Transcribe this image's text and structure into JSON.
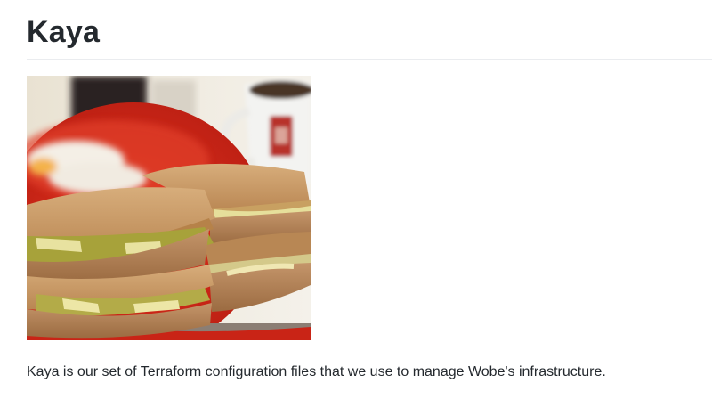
{
  "readme": {
    "title": "Kaya",
    "image": {
      "alt": "Kaya toast sandwiches on a red plate with soft-boiled eggs and a cup of coffee"
    },
    "description": "Kaya is our set of Terraform configuration files that we use to manage Wobe's infrastructure."
  },
  "colors": {
    "text": "#24292e",
    "divider": "#eaecef",
    "plate_red": "#d9291b",
    "toast": "#c99a63",
    "kaya_green": "#a7a23a",
    "butter": "#e8e2a0"
  }
}
